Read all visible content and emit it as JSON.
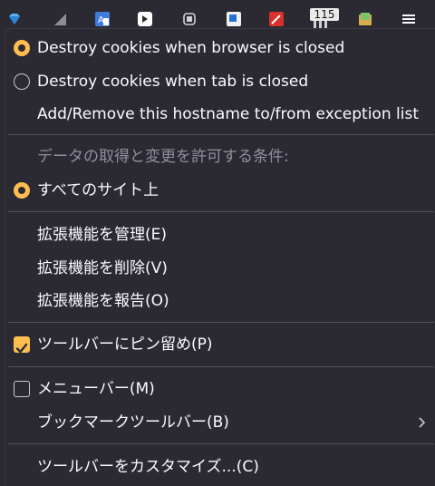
{
  "toolbar": {
    "icons": [
      "gem-icon",
      "arrow-icon",
      "translate-icon",
      "script-icon",
      "chip-icon",
      "container-icon",
      "magic-wand-icon",
      "counter-extension-icon",
      "notes-icon",
      "menu-icon"
    ],
    "badge": "115"
  },
  "menu": {
    "cookie_options": [
      {
        "label": "Destroy cookies when browser is closed",
        "checked": true
      },
      {
        "label": "Destroy cookies when tab is closed",
        "checked": false
      }
    ],
    "exception_label": "Add/Remove this hostname to/from exception list",
    "permission_header": "データの取得と変更を許可する条件:",
    "all_sites_label": "すべてのサイト上",
    "manage_label": "拡張機能を管理(E)",
    "remove_label": "拡張機能を削除(V)",
    "report_label": "拡張機能を報告(O)",
    "pin_label": "ツールバーにピン留め(P)",
    "pin_checked": true,
    "menubar_label": "メニューバー(M)",
    "menubar_checked": false,
    "bookmarks_toolbar_label": "ブックマークツールバー(B)",
    "customize_label": "ツールバーをカスタマイズ...(C)"
  },
  "colors": {
    "accent": "#ffbd4f",
    "background": "#2b2a33",
    "text": "#fbfbfe",
    "disabled_text": "#8f8f9d",
    "separator": "#52525e"
  }
}
